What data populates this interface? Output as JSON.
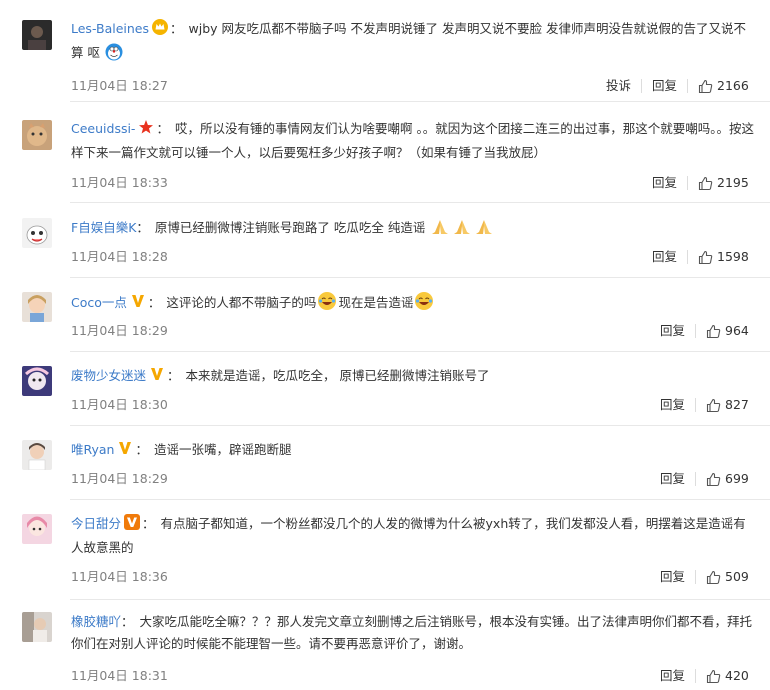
{
  "actions": {
    "report": "投诉",
    "reply": "回复"
  },
  "colors": {
    "name": "#3d7bc8",
    "time": "#808080",
    "text": "#333333"
  },
  "comments": [
    {
      "user": "Les-Baleines",
      "badge": "crown",
      "text": "wjby 网友吃瓜都不带脑子吗 不发声明说锤了 发声明又说不要脸 发律师声明没告就说假的告了又说不算 呕",
      "emoji": [
        "doraemon"
      ],
      "time": "11月04日 18:27",
      "likes": "2166",
      "report": true
    },
    {
      "user": "Ceeuidssi-",
      "badge": "red-star",
      "text": "哎，所以没有锤的事情网友们认为啥要嘲啊 。。就因为这个团接二连三的出过事，那这个就要嘲吗。。按这样下来一篇作文就可以锤一个人，以后要冤枉多少好孩子啊？（如果有锤了当我放屁）",
      "emoji": [],
      "time": "11月04日 18:33",
      "likes": "2195",
      "report": false
    },
    {
      "user": "F自娱自樂K",
      "badge": "",
      "text": "原博已经删微博注销账号跑路了 吃瓜吃全 纯造谣",
      "emoji": [
        "pray",
        "pray",
        "pray"
      ],
      "time": "11月04日 18:28",
      "likes": "1598",
      "report": false
    },
    {
      "user": "Coco一点",
      "badge": "v-gold",
      "text": "这评论的人都不带脑子的吗",
      "text2": "现在是告造谣",
      "emoji": [
        "laugh"
      ],
      "emoji2": [
        "laugh"
      ],
      "time": "11月04日 18:29",
      "likes": "964",
      "report": false
    },
    {
      "user": "废物少女迷迷",
      "badge": "v-gold",
      "text": "本来就是造谣，吃瓜吃全， 原博已经删微博注销账号了",
      "emoji": [],
      "time": "11月04日 18:30",
      "likes": "827",
      "report": false
    },
    {
      "user": "唯Ryan",
      "badge": "v-gold",
      "text": "造谣一张嘴，辟谣跑断腿",
      "emoji": [],
      "time": "11月04日 18:29",
      "likes": "699",
      "report": false
    },
    {
      "user": "今日甜分",
      "badge": "v-orange",
      "text": "有点脑子都知道，一个粉丝都没几个的人发的微博为什么被yxh转了，我们发都没人看，明摆着这是造谣有人故意黑的",
      "emoji": [],
      "time": "11月04日 18:36",
      "likes": "509",
      "report": false
    },
    {
      "user": "橡胶糖吖",
      "badge": "",
      "text": "大家吃瓜能吃全嘛？？？那人发完文章立刻删博之后注销账号，根本没有实锤。出了法律声明你们都不看，拜托你们在对别人评论的时候能不能理智一些。请不要再恶意评价了，谢谢。",
      "emoji": [],
      "time": "11月04日 18:31",
      "likes": "420",
      "report": false
    }
  ]
}
